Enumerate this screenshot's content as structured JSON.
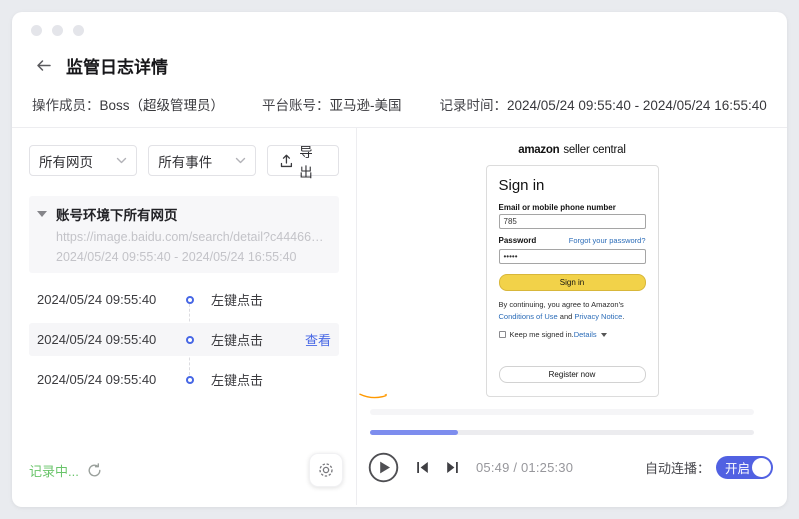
{
  "window": {
    "title": "监管日志详情"
  },
  "info_bar": {
    "operator": {
      "label": "操作成员：",
      "value": "Boss（超级管理员）"
    },
    "platform": {
      "label": "平台账号：",
      "value": "亚马逊-美国"
    },
    "record_time": {
      "label": "记录时间：",
      "value": "2024/05/24 09:55:40 - 2024/05/24 16:55:40"
    }
  },
  "left_panel": {
    "filters": {
      "pages_dropdown": "所有网页",
      "events_dropdown": "所有事件",
      "export_label": "导出"
    },
    "tree": {
      "title": "账号环境下所有网页",
      "url": "https://image.baidu.com/search/detail?c44466665454...",
      "time_range": "2024/05/24 09:55:40 - 2024/05/24 16:55:40"
    },
    "events": [
      {
        "time": "2024/05/24 09:55:40",
        "action": "左键点击"
      },
      {
        "time": "2024/05/24 09:55:40",
        "action": "左键点击",
        "link": "查看"
      },
      {
        "time": "2024/05/24 09:55:40",
        "action": "左键点击"
      }
    ],
    "status": {
      "recording": "记录中..."
    }
  },
  "preview": {
    "logo": {
      "brand": "amazon",
      "suffix": "seller central"
    },
    "signin": {
      "title": "Sign in",
      "email_label": "Email or mobile phone number",
      "email_value": "785",
      "password_label": "Password",
      "forgot_link": "Forgot your password?",
      "password_value": "•••••",
      "signin_button": "Sign in",
      "legal_prefix": "By continuing, you agree to Amazon's ",
      "legal_link1": "Conditions of Use",
      "legal_mid": " and ",
      "legal_link2": "Privacy Notice",
      "legal_suffix": ".",
      "keep_signed": "Keep me signed in. ",
      "details_link": "Details",
      "register_button": "Register now"
    }
  },
  "player": {
    "progress_percent": 23,
    "time_display": "05:49 / 01:25:30",
    "autoplay_label": "自动连播：",
    "toggle_label": "开启"
  },
  "colors": {
    "accent_blue": "#4767e5",
    "player_purple": "#7d8dee",
    "toggle_purple": "#5161e2",
    "success_green": "#69c46a",
    "amazon_yellow": "#f2d249",
    "amazon_orange": "#ff9900",
    "amazon_link_blue": "#2b6cb8"
  }
}
